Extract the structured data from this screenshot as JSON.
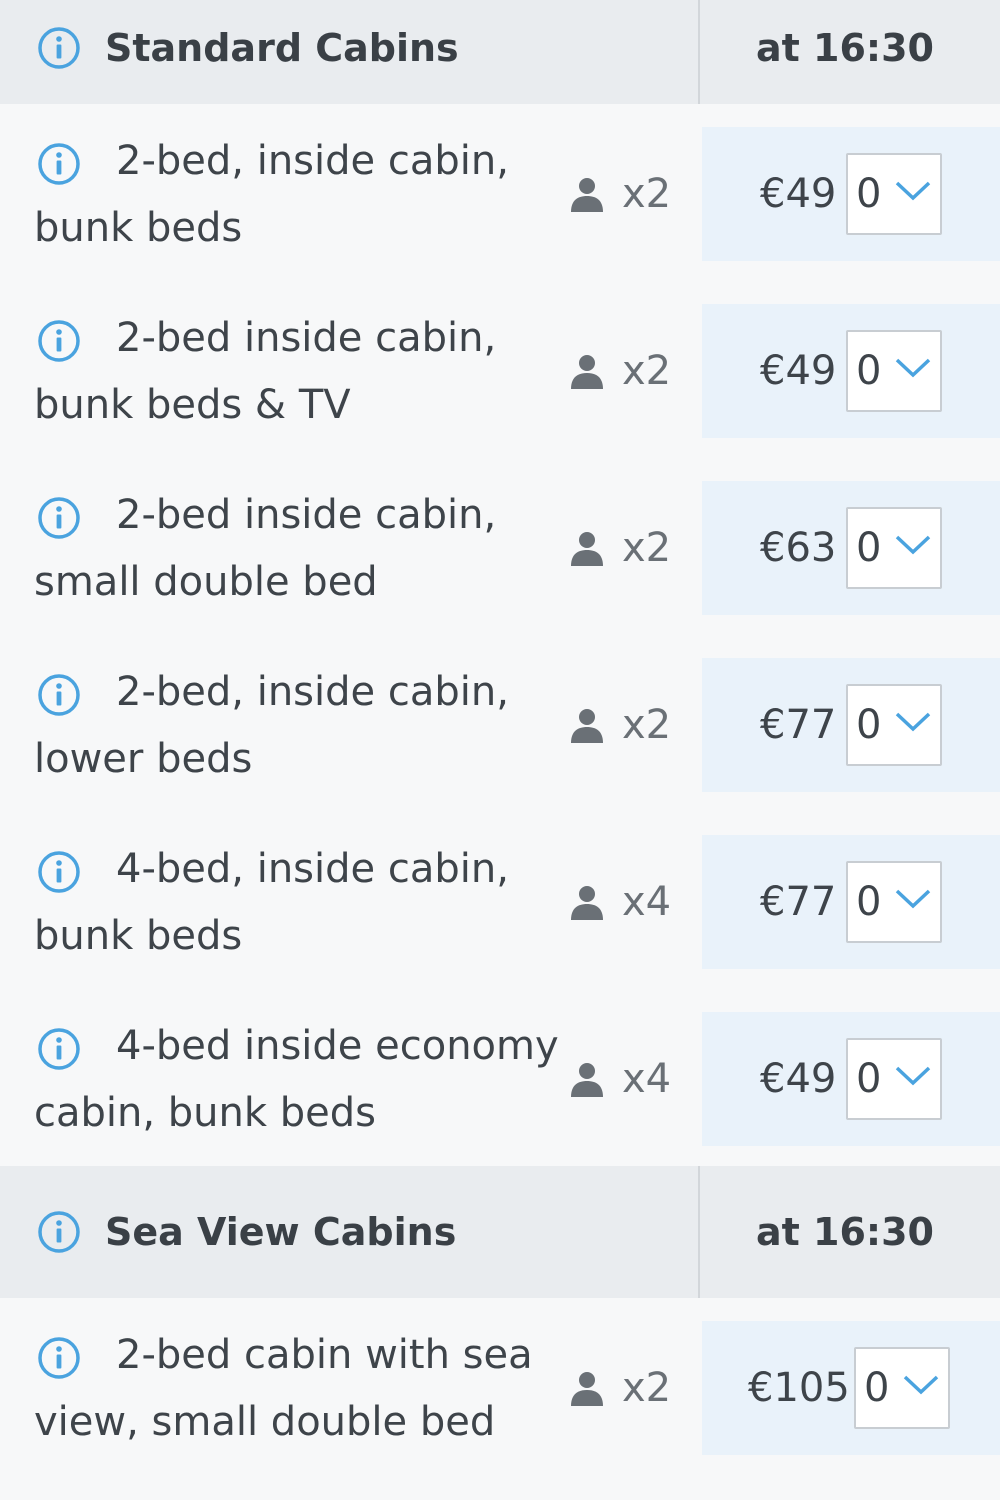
{
  "sections": [
    {
      "title": "Standard Cabins",
      "time": "at 16:30",
      "rows": [
        {
          "line1": "2-bed, inside cabin,",
          "line2": "bunk beds",
          "capacity": "x2",
          "price": "€49",
          "qty": "0"
        },
        {
          "line1": "2-bed inside cabin,",
          "line2": "bunk beds & TV",
          "capacity": "x2",
          "price": "€49",
          "qty": "0"
        },
        {
          "line1": "2-bed inside cabin,",
          "line2": "small double bed",
          "capacity": "x2",
          "price": "€63",
          "qty": "0"
        },
        {
          "line1": "2-bed, inside cabin,",
          "line2": "lower beds",
          "capacity": "x2",
          "price": "€77",
          "qty": "0"
        },
        {
          "line1": "4-bed, inside cabin,",
          "line2": "bunk beds",
          "capacity": "x4",
          "price": "€77",
          "qty": "0"
        },
        {
          "line1": "4-bed inside economy",
          "line2": "cabin, bunk beds",
          "capacity": "x4",
          "price": "€49",
          "qty": "0"
        }
      ]
    },
    {
      "title": "Sea View Cabins",
      "time": "at 16:30",
      "rows": [
        {
          "line1": "2-bed cabin with sea",
          "line2": "view, small double bed",
          "capacity": "x2",
          "price": "€105",
          "qty": "0"
        }
      ]
    }
  ],
  "icons": {
    "info": "info-circle-icon",
    "person": "person-icon",
    "dropdown": "chevron-down-icon"
  },
  "colors": {
    "accent": "#4aa3df",
    "header_bg": "#e9ecef",
    "price_bg": "#e9f2fa"
  }
}
